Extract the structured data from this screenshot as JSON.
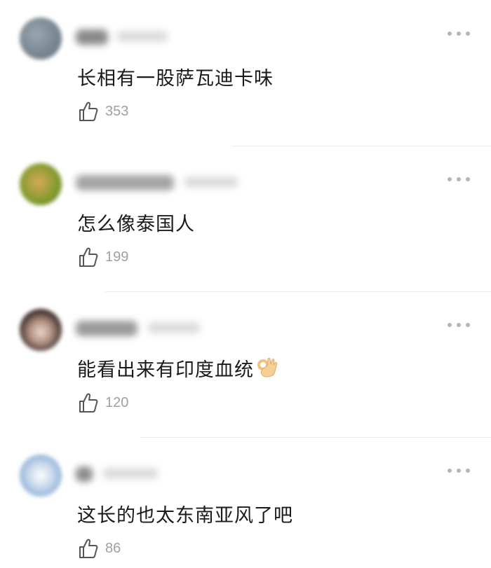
{
  "comments": [
    {
      "text": "长相有一股萨瓦迪卡味",
      "likes": "353",
      "accent": "#6b7f8e"
    },
    {
      "text": "怎么像泰国人",
      "likes": "199",
      "accent": "#9fb23c"
    },
    {
      "text": "能看出来有印度血统",
      "likes": "120",
      "emoji": "ok-hand-icon",
      "accent": "#7a5a52"
    },
    {
      "text": "这长的也太东南亚风了吧",
      "likes": "86",
      "accent": "#8fb0d6"
    }
  ]
}
